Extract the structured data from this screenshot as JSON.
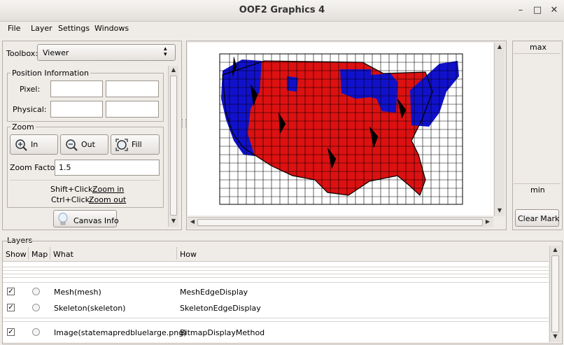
{
  "window": {
    "title": "OOF2 Graphics 4"
  },
  "menubar": {
    "items": [
      "File",
      "Layer",
      "Settings",
      "Windows"
    ]
  },
  "toolbox": {
    "label": "Toolbox:",
    "selected": "Viewer",
    "position_group": "Position Information",
    "pixel_label": "Pixel:",
    "physical_label": "Physical:",
    "pixel_x": "",
    "pixel_y": "",
    "physical_x": "",
    "physical_y": "",
    "zoom_group": "Zoom",
    "zoom_in": "In",
    "zoom_out": "Out",
    "zoom_fill": "Fill",
    "zoom_factor_label": "Zoom Factor:",
    "zoom_factor": "1.5",
    "hint1_prefix": "Shift+Click:",
    "hint1_link": "Zoom in",
    "hint2_prefix": "Ctrl+Click:",
    "hint2_link": "Zoom out",
    "canvas_info": "Canvas Info"
  },
  "contour": {
    "max": "max",
    "min": "min",
    "clear_mark": "Clear Mark"
  },
  "layers": {
    "title": "Layers",
    "columns": [
      "Show",
      "Map",
      "What",
      "How"
    ],
    "rows": [
      {
        "show": true,
        "what": "Mesh(mesh)",
        "how": "MeshEdgeDisplay"
      },
      {
        "show": true,
        "what": "Skeleton(skeleton)",
        "how": "SkeletonEdgeDisplay"
      },
      {
        "show": true,
        "what": "Image(statemapredbluelarge.png)",
        "how": "BitmapDisplayMethod"
      }
    ]
  },
  "colors": {
    "red_states": "#dd1111",
    "blue_states": "#1111cc",
    "mesh_lines": "#000000"
  }
}
